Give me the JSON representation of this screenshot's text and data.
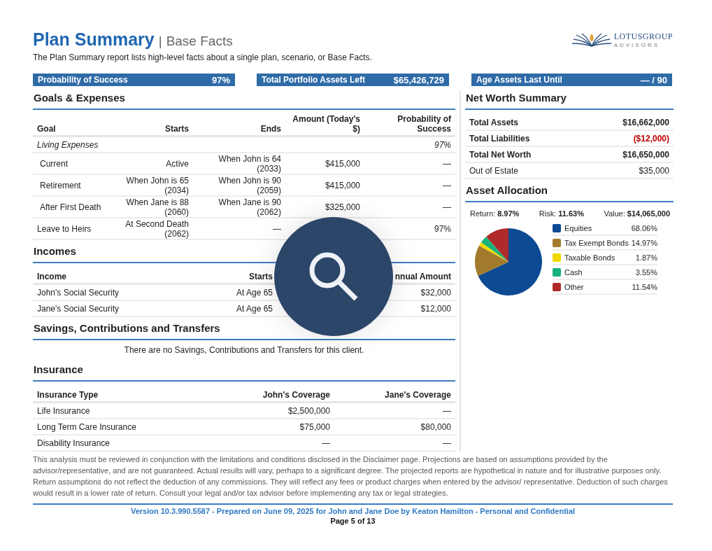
{
  "header": {
    "title": "Plan Summary",
    "separator": "|",
    "subtitle": "Base Facts",
    "description": "The Plan Summary report lists high-level facts about a single plan, scenario, or Base Facts."
  },
  "logo": {
    "name": "LOTUSGROUP",
    "tagline": "ADVISORS"
  },
  "highlights": [
    {
      "label": "Probability of Success",
      "value": "97%"
    },
    {
      "label": "Total Portfolio Assets Left",
      "value": "$65,426,729"
    },
    {
      "label": "Age Assets Last Until",
      "value": "— / 90"
    }
  ],
  "goals": {
    "title": "Goals & Expenses",
    "columns": [
      "Goal",
      "Starts",
      "Ends",
      "Amount (Today's $)",
      "Probability of Success"
    ],
    "rows": [
      {
        "kind": "group",
        "goal": "Living Expenses",
        "probability": "97%"
      },
      {
        "kind": "sub",
        "goal": "Current",
        "starts": "Active",
        "ends": "When John is 64 (2033)",
        "amount": "$415,000",
        "probability": "—"
      },
      {
        "kind": "sub",
        "goal": "Retirement",
        "starts": "When John is 65 (2034)",
        "ends": "When John is 90 (2059)",
        "amount": "$415,000",
        "probability": "—"
      },
      {
        "kind": "sub",
        "goal": "After First Death",
        "starts": "When Jane is 88 (2060)",
        "ends": "When Jane is 90 (2062)",
        "amount": "$325,000",
        "probability": "—"
      },
      {
        "kind": "goal",
        "goal": "Leave to Heirs",
        "starts": "At Second Death (2062)",
        "ends": "—",
        "probability": "97%"
      }
    ]
  },
  "incomes": {
    "title": "Incomes",
    "columns": [
      "Income",
      "Starts",
      "nnual Amount"
    ],
    "rows": [
      {
        "income": "John's Social Security",
        "starts": "At Age 65",
        "amount": "$32,000"
      },
      {
        "income": "Jane's Social Security",
        "starts": "At Age 65",
        "amount": "$12,000"
      }
    ]
  },
  "savings": {
    "title": "Savings, Contributions and Transfers",
    "message": "There are no Savings, Contributions and Transfers for this client."
  },
  "insurance": {
    "title": "Insurance",
    "columns": [
      "Insurance Type",
      "John's Coverage",
      "Jane's Coverage"
    ],
    "rows": [
      {
        "type": "Life Insurance",
        "john": "$2,500,000",
        "jane": "—"
      },
      {
        "type": "Long Term Care Insurance",
        "john": "$75,000",
        "jane": "$80,000"
      },
      {
        "type": "Disability Insurance",
        "john": "—",
        "jane": "—"
      }
    ]
  },
  "net_worth": {
    "title": "Net Worth Summary",
    "rows": [
      {
        "kind": "total",
        "label": "Total Assets",
        "value": "$16,662,000",
        "negative": false
      },
      {
        "kind": "total",
        "label": "Total Liabilities",
        "value": "($12,000)",
        "negative": true
      },
      {
        "kind": "total",
        "label": "Total Net Worth",
        "value": "$16,650,000",
        "negative": false
      },
      {
        "kind": "plain",
        "label": "Out of Estate",
        "value": "$35,000",
        "negative": false
      }
    ]
  },
  "asset_allocation": {
    "title": "Asset Allocation",
    "stats": [
      {
        "label": "Return:",
        "value": "8.97%"
      },
      {
        "label": "Risk:",
        "value": "11.63%"
      },
      {
        "label": "Value:",
        "value": "$14,065,000"
      }
    ],
    "chart_data": {
      "type": "pie",
      "categories": [
        "Equities",
        "Tax Exempt Bonds",
        "Taxable Bonds",
        "Cash",
        "Other"
      ],
      "values": [
        68.06,
        14.97,
        1.87,
        3.55,
        11.54
      ]
    },
    "legend": [
      {
        "percent": "68.06%",
        "color": "#0d4a94"
      },
      {
        "percent": "14.97%",
        "color": "#a27a2c"
      },
      {
        "percent": "1.87%",
        "color": "#f3d800"
      },
      {
        "percent": "3.55%",
        "color": "#16b27a"
      },
      {
        "percent": "11.54%",
        "color": "#b02a2a"
      }
    ]
  },
  "disclaimer": "This analysis must be reviewed in conjunction with the limitations and conditions disclosed in the Disclaimer page. Projections are based on assumptions provided by the advisor/representative, and are not guaranteed. Actual results will vary, perhaps to a significant degree. The projected reports are hypothetical in nature and for illustrative purposes only. Return assumptions do not reflect the deduction of any commissions. They will reflect any fees or product charges when entered by the advisor/ representative. Deduction of such charges would result in a lower rate of return. Consult your legal and/or tax advisor before implementing any tax or legal strategies.",
  "footer": {
    "version": "Version 10.3.990.5587 - Prepared on June 09, 2025 for John and Jane Doe by Keaton Hamilton - Personal and Confidential",
    "page": "Page 5 of 13"
  }
}
